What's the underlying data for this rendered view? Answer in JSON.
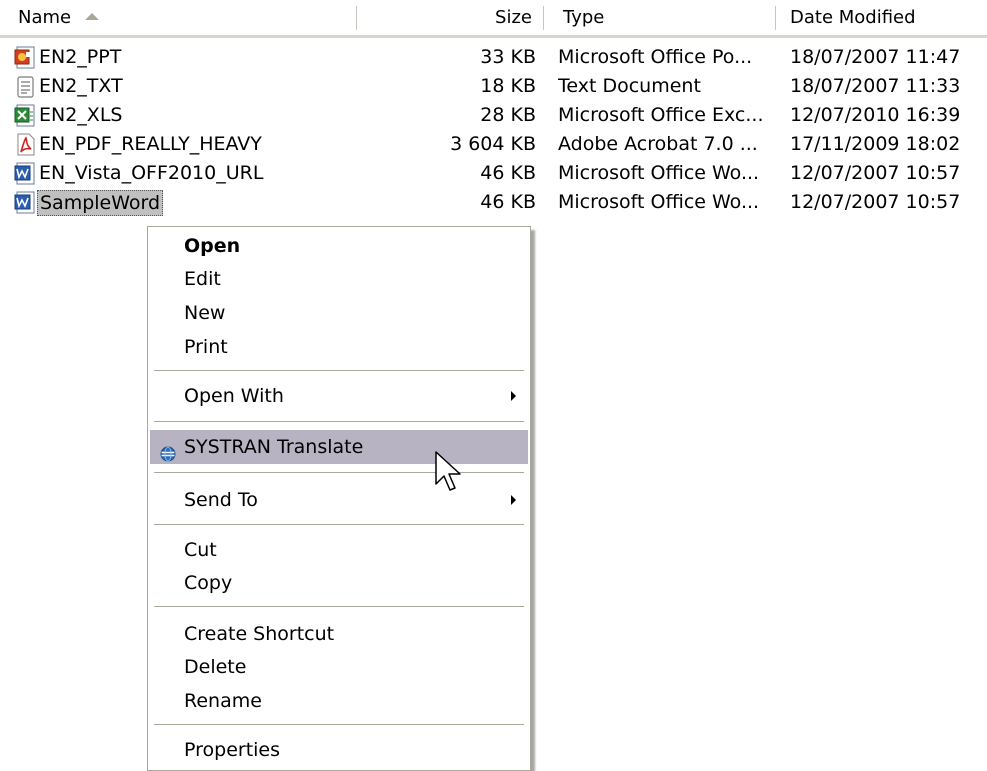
{
  "columns": {
    "name": "Name",
    "size": "Size",
    "type": "Type",
    "date": "Date Modified"
  },
  "files": [
    {
      "name": "EN2_PPT",
      "size": "33 KB",
      "type": "Microsoft Office Po...",
      "date": "18/07/2007 11:47",
      "icon": "powerpoint-file-icon"
    },
    {
      "name": "EN2_TXT",
      "size": "18 KB",
      "type": "Text Document",
      "date": "18/07/2007 11:33",
      "icon": "text-file-icon"
    },
    {
      "name": "EN2_XLS",
      "size": "28 KB",
      "type": "Microsoft Office Exc...",
      "date": "12/07/2010 16:39",
      "icon": "excel-file-icon"
    },
    {
      "name": "EN_PDF_REALLY_HEAVY",
      "size": "3 604 KB",
      "type": "Adobe Acrobat 7.0 ...",
      "date": "17/11/2009 18:02",
      "icon": "pdf-file-icon"
    },
    {
      "name": "EN_Vista_OFF2010_URL",
      "size": "46 KB",
      "type": "Microsoft Office Wo...",
      "date": "12/07/2007 10:57",
      "icon": "word-file-icon"
    },
    {
      "name": "SampleWord",
      "size": "46 KB",
      "type": "Microsoft Office Wo...",
      "date": "12/07/2007 10:57",
      "icon": "word-file-icon",
      "selected": true
    }
  ],
  "context_menu": {
    "open": "Open",
    "edit": "Edit",
    "new": "New",
    "print": "Print",
    "open_with": "Open With",
    "systran_translate": "SYSTRAN Translate",
    "send_to": "Send To",
    "cut": "Cut",
    "copy": "Copy",
    "create_shortcut": "Create Shortcut",
    "delete": "Delete",
    "rename": "Rename",
    "properties": "Properties"
  },
  "colors": {
    "highlight": "#b7b3c3",
    "header_border": "#d5d6cc",
    "selection": "#c0c0c0"
  }
}
